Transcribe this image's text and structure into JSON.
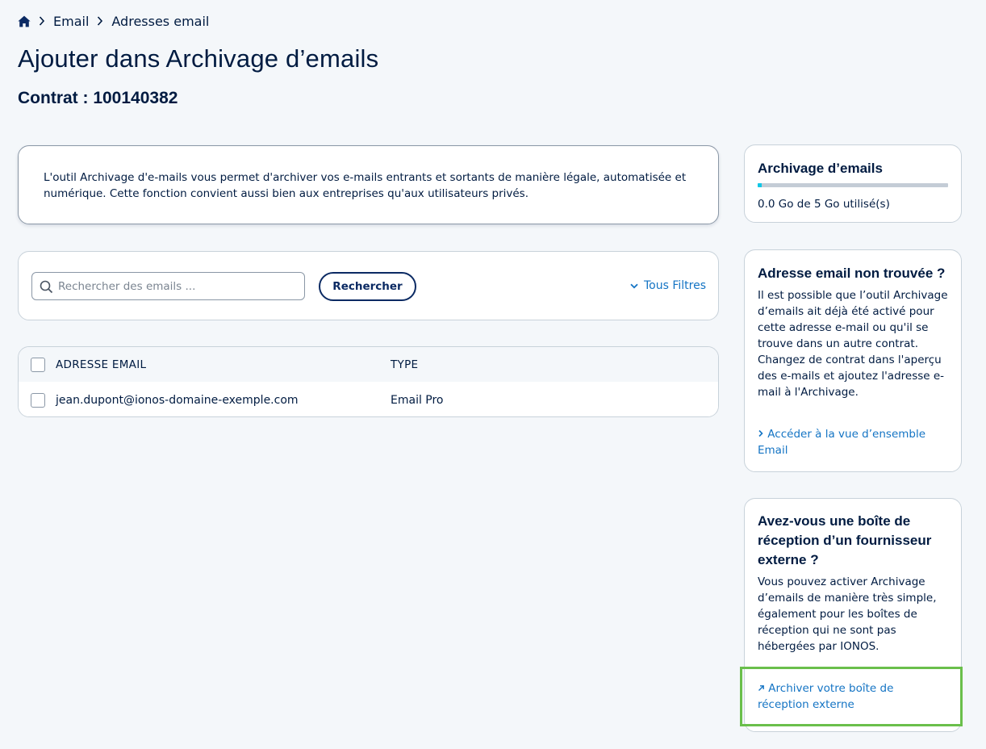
{
  "breadcrumb": {
    "home_icon": "home-icon",
    "items": [
      "Email",
      "Adresses email"
    ]
  },
  "page": {
    "title": "Ajouter dans Archivage d’emails",
    "contract": "Contrat : 100140382"
  },
  "intro": {
    "text": "L'outil Archivage d'e-mails vous permet d'archiver vos e-mails entrants et sortants de manière légale, automatisée et numérique. Cette fonction convient aussi bien aux entreprises qu'aux utilisateurs privés."
  },
  "search": {
    "placeholder": "Rechercher des emails ...",
    "button": "Rechercher",
    "filters": "Tous Filtres"
  },
  "table": {
    "columns": [
      "ADRESSE EMAIL",
      "TYPE"
    ],
    "rows": [
      {
        "email": "jean.dupont@ionos-domaine-exemple.com",
        "type": "Email Pro"
      }
    ]
  },
  "usage_card": {
    "title": "Archivage d’emails",
    "used_fraction": 0.02,
    "text": "0.0 Go de 5 Go utilisé(s)"
  },
  "not_found_card": {
    "title": "Adresse email non trouvée ?",
    "text": "Il est possible que l’outil Archivage d’emails ait déjà été activé pour cette adresse e-mail ou qu'il se trouve dans un autre contrat. Changez de contrat dans l'aperçu des e-mails et ajoutez l'adresse e-mail à l'Archivage.",
    "link": "Accéder à la vue d’ensemble Email"
  },
  "external_card": {
    "title": "Avez-vous une boîte de réception d’un fournisseur externe ?",
    "text": "Vous pouvez activer Archivage d’emails de manière très simple, également pour les boîtes de réception qui ne sont pas hébergées par IONOS.",
    "link": "Archiver votre boîte de réception externe"
  },
  "colors": {
    "text": "#001b41",
    "link": "#1474c4",
    "progress": "#11c7e6",
    "highlight": "#6abf4b",
    "background": "#f4f7fa"
  }
}
